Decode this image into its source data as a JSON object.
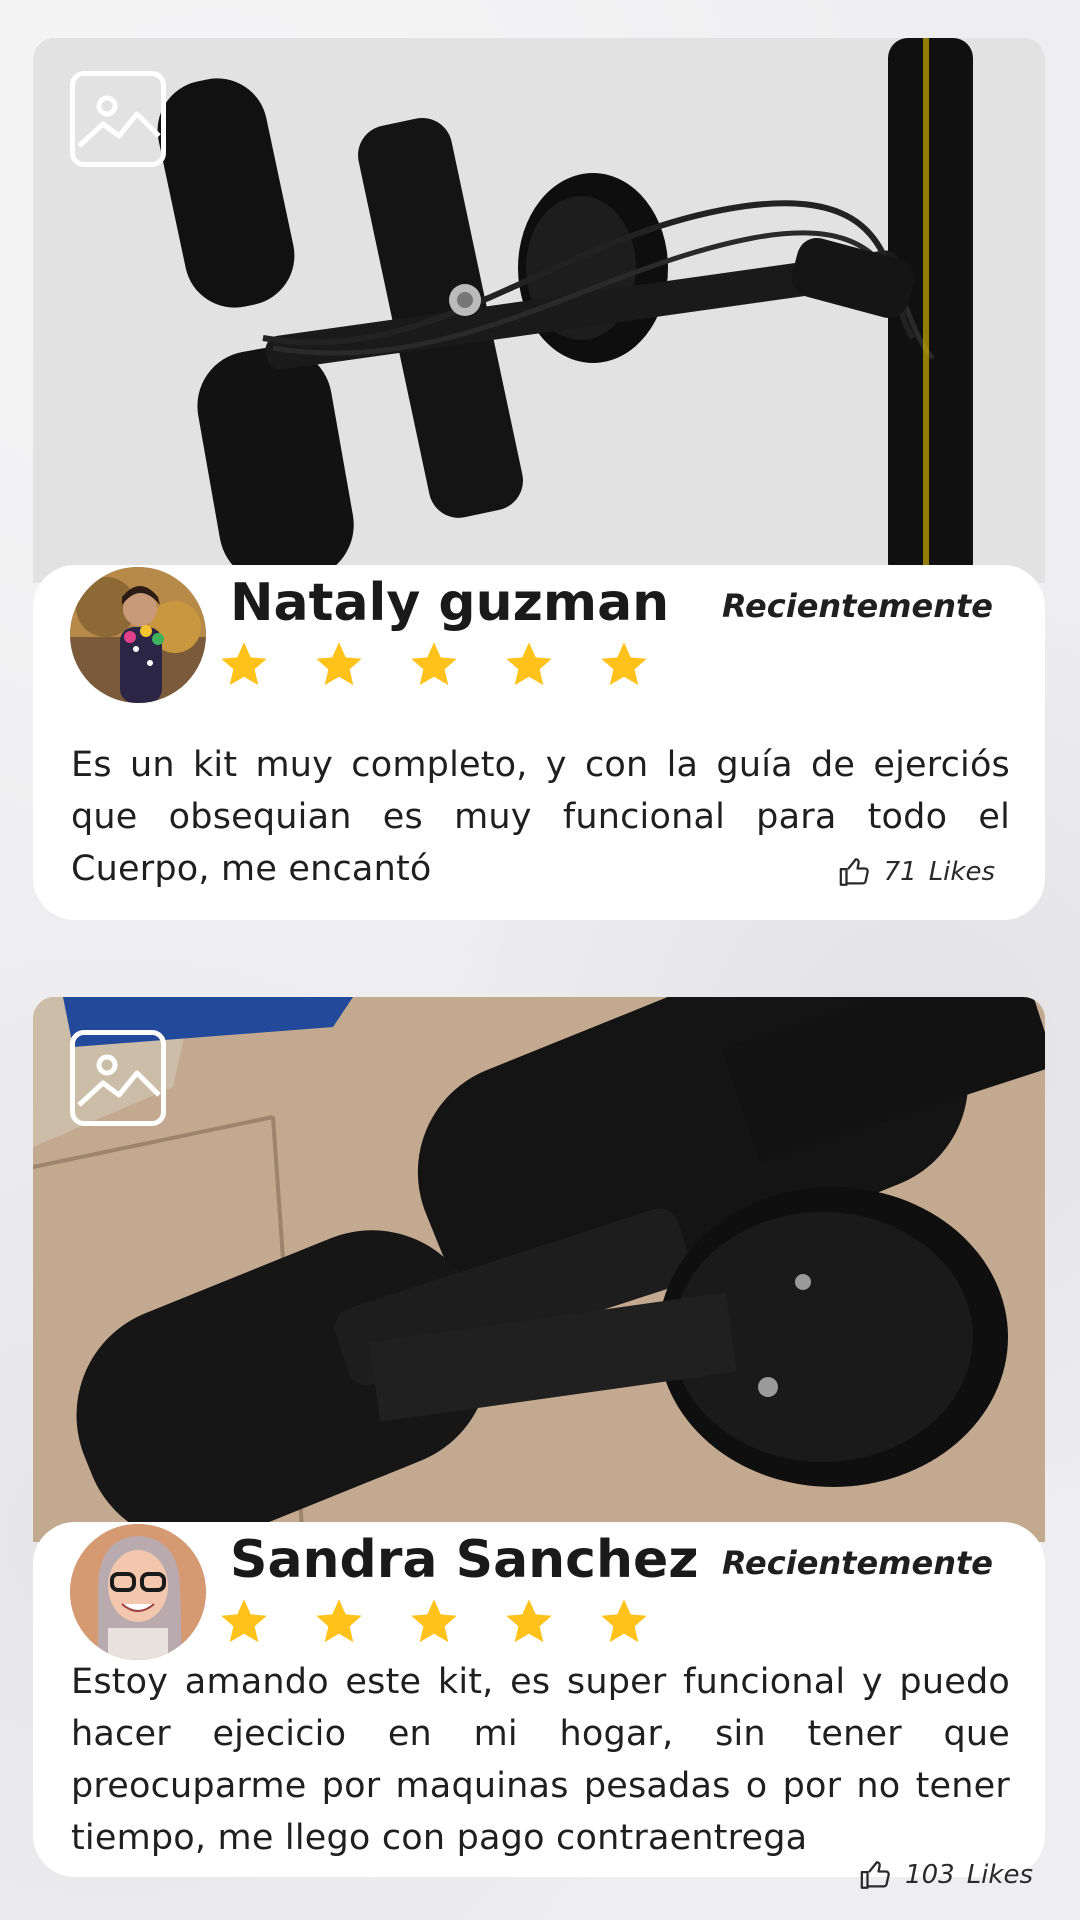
{
  "reviews": [
    {
      "name": "Nataly guzman",
      "date": "Recientemente",
      "rating": 5,
      "text": "Es un kit muy completo, y con la guía de ejerciós que obsequian es muy funcional para todo el Cuerpo, me encantó",
      "likes": "71",
      "likes_label": "Likes",
      "photo_icon": "image-icon",
      "avatar_icon": "avatar"
    },
    {
      "name": "Sandra Sanchez",
      "date": "Recientemente",
      "rating": 5,
      "text": " Estoy amando este kit, es super funcional y puedo hacer ejecicio en mi hogar, sin tener que preocuparme por maquinas pesadas o por no tener tiempo, me llego con pago contraentrega",
      "likes": "103",
      "likes_label": "Likes",
      "photo_icon": "image-icon",
      "avatar_icon": "avatar"
    }
  ],
  "colors": {
    "star": "#FFC21A",
    "card": "#FFFFFF",
    "text": "#1F1F1F"
  }
}
